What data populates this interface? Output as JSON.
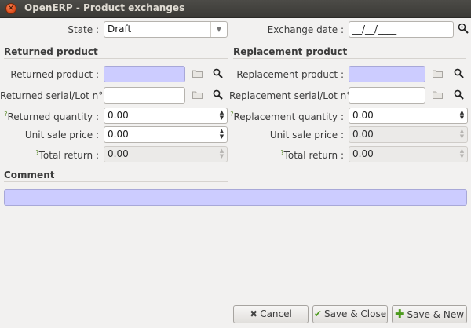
{
  "window": {
    "title": "OpenERP - Product exchanges"
  },
  "header": {
    "state_label": "State :",
    "state_value": "Draft",
    "exchange_date_label": "Exchange date :",
    "exchange_date_value": "__/__/____"
  },
  "returned": {
    "section_title": "Returned product",
    "product_label": "Returned product :",
    "product_value": "",
    "serial_label": "Returned serial/Lot n° :",
    "serial_value": "",
    "quantity_label": "Returned quantity :",
    "quantity_value": "0.00",
    "unit_price_label": "Unit sale price :",
    "unit_price_value": "0.00",
    "total_label": "Total return :",
    "total_value": "0.00"
  },
  "replacement": {
    "section_title": "Replacement product",
    "product_label": "Replacement product :",
    "product_value": "",
    "serial_label": "Replacement serial/Lot n° :",
    "serial_value": "",
    "quantity_label": "Replacement quantity :",
    "quantity_value": "0.00",
    "unit_price_label": "Unit sale price :",
    "unit_price_value": "0.00",
    "total_label": "Total return :",
    "total_value": "0.00"
  },
  "comment": {
    "section_title": "Comment",
    "value": ""
  },
  "help_mark": "?",
  "buttons": {
    "cancel": "Cancel",
    "save_close": "Save & Close",
    "save_new": "Save & New"
  },
  "icons": {
    "close": "close-icon",
    "dropdown": "chevron-down-icon",
    "calendar": "zoom-in-icon",
    "open": "folder-icon",
    "search": "search-icon",
    "cancel": "x-icon",
    "save_close": "check-icon",
    "save_new": "plus-icon"
  },
  "colors": {
    "required_field": "#ccccff",
    "titlebar": "#3c3b37",
    "close_button": "#e0501e",
    "window_bg": "#f2f1f0"
  }
}
